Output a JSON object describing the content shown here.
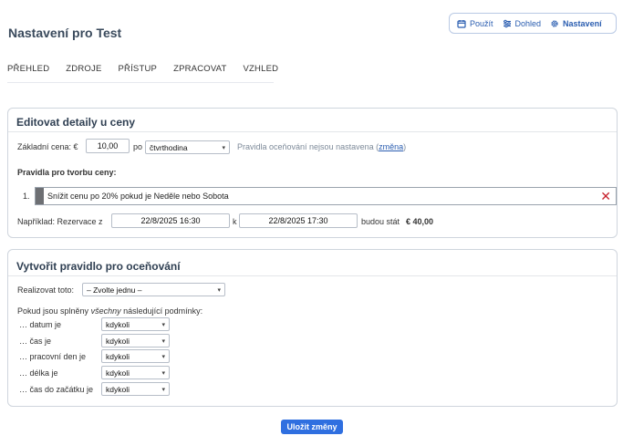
{
  "topnav": {
    "items": [
      {
        "label": "Použít",
        "icon": "calendar-icon"
      },
      {
        "label": "Dohled",
        "icon": "sliders-icon"
      },
      {
        "label": "Nastavení",
        "icon": "gear-icon",
        "active": true
      }
    ]
  },
  "page_title": "Nastavení pro Test",
  "tabs": [
    "PŘEHLED",
    "ZDROJE",
    "PŘÍSTUP",
    "ZPRACOVAT",
    "VZHLED"
  ],
  "edit_card": {
    "title": "Editovat detaily u ceny",
    "base_price_label": "Základní cena: €",
    "base_price_value": "10,00",
    "per_label": "po",
    "per_unit": "čtvrthodina",
    "rules_hint": "Pravidla oceňování nejsou nastavena (",
    "rules_hint_link": "změna",
    "rules_hint_end": ")",
    "rules_heading": "Pravidla pro tvorbu ceny:",
    "rules": [
      {
        "number": "1.",
        "text": "Snížit cenu po 20% pokud je Neděle nebo Sobota"
      }
    ],
    "example_label": "Například: Rezervace z",
    "example_from": "22/8/2025 16:30",
    "example_to_label": "k",
    "example_to": "22/8/2025 17:30",
    "example_result_label": "budou stát",
    "example_result_value": "€ 40,00"
  },
  "create_card": {
    "title": "Vytvořit pravidlo pro oceňování",
    "action_label": "Realizovat toto:",
    "action_value": "– Zvolte jednu –",
    "conditions_prefix": "Pokud jsou splněny ",
    "conditions_em": "všechny",
    "conditions_suffix": " následující podmínky:",
    "conditions": [
      {
        "label": "… datum je",
        "value": "kdykoli"
      },
      {
        "label": "… čas je",
        "value": "kdykoli"
      },
      {
        "label": "… pracovní den je",
        "value": "kdykoli"
      },
      {
        "label": "… délka je",
        "value": "kdykoli"
      },
      {
        "label": "… čas do začátku je",
        "value": "kdykoli"
      }
    ]
  },
  "save_button": "Uložit změny",
  "colors": {
    "accent": "#2f6fe0",
    "link": "#2a5db0",
    "delete": "#c7232e"
  }
}
